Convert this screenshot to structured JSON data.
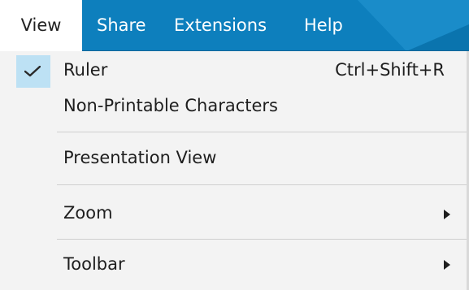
{
  "menubar": {
    "items": [
      {
        "label": "View",
        "active": true
      },
      {
        "label": "Share",
        "active": false
      },
      {
        "label": "Extensions",
        "active": false
      },
      {
        "label": "Help",
        "active": false
      }
    ],
    "colors": {
      "background": "#0d7fbd",
      "active_background": "#ffffff",
      "text": "#ffffff"
    }
  },
  "dropdown": {
    "items": [
      {
        "label": "Ruler",
        "shortcut": "Ctrl+Shift+R",
        "checked": true,
        "icon": "checkmark-icon"
      },
      {
        "label": "Non-Printable Characters",
        "checked": false
      },
      {
        "label": "Presentation View",
        "checked": false
      },
      {
        "label": "Zoom",
        "submenu": true,
        "icon": "submenu-arrow-icon"
      },
      {
        "label": "Toolbar",
        "submenu": true,
        "icon": "submenu-arrow-icon"
      }
    ],
    "colors": {
      "background": "#f3f3f3",
      "check_highlight": "#bde1f4",
      "separator": "#cfcfcf"
    }
  }
}
